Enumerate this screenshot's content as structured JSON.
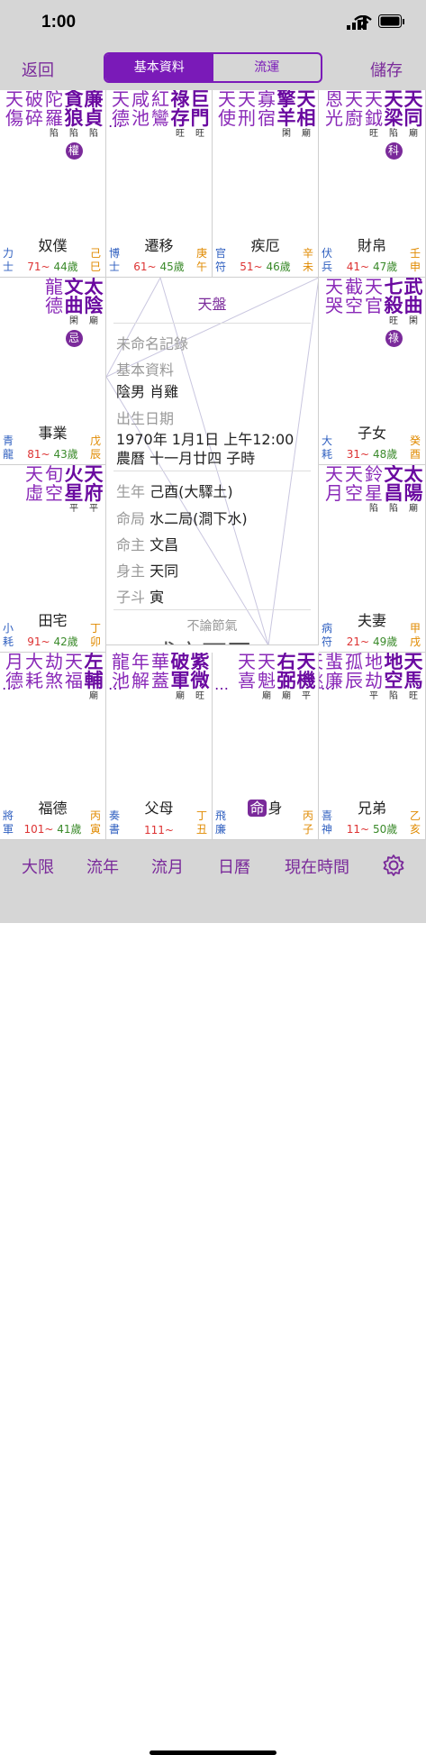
{
  "status": {
    "time": "1:00"
  },
  "nav": {
    "back": "返回",
    "tab_basic": "基本資料",
    "tab_flow": "流運",
    "save": "儲存"
  },
  "palaces": [
    {
      "name": "奴僕",
      "stars": [
        "天傷",
        "破碎",
        "陀羅",
        "貪狼",
        "廉貞"
      ],
      "brightness": [
        "陷",
        "陷",
        "陷"
      ],
      "hua": "權",
      "lt": "力士",
      "gz": "己巳",
      "age1": "71~",
      "age2": "44歲"
    },
    {
      "name": "遷移",
      "stars": [
        "天德",
        "咸池",
        "紅鸞",
        "祿存",
        "巨門"
      ],
      "brightness": [
        "旺",
        "旺"
      ],
      "more": "…",
      "lt": "博士",
      "gz": "庚午",
      "age1": "61~",
      "age2": "45歲"
    },
    {
      "name": "疾厄",
      "stars": [
        "天使",
        "天刑",
        "寡宿",
        "擎羊",
        "天相"
      ],
      "brightness": [
        "廟",
        "閑"
      ],
      "lt": "官符",
      "gz": "辛未",
      "age1": "51~",
      "age2": "46歲"
    },
    {
      "name": "財帛",
      "stars": [
        "恩光",
        "天廚",
        "天鉞",
        "天梁",
        "天同"
      ],
      "brightness": [
        "廟",
        "陷",
        "旺"
      ],
      "hua": "科",
      "lt": "伏兵",
      "gz": "壬申",
      "age1": "41~",
      "age2": "47歲"
    },
    {
      "name": "事業",
      "stars": [
        "龍德",
        "文曲",
        "太陰"
      ],
      "brightness": [
        "廟",
        "閑"
      ],
      "hua": "忌",
      "lt": "青龍",
      "gz": "戊辰",
      "age1": "81~",
      "age2": "43歲"
    },
    {
      "name": "子女",
      "stars": [
        "天哭",
        "截空",
        "天官",
        "七殺",
        "武曲"
      ],
      "brightness": [
        "閑",
        "旺"
      ],
      "hua": "祿",
      "lt": "大耗",
      "gz": "癸酉",
      "age1": "31~",
      "age2": "48歲"
    },
    {
      "name": "田宅",
      "stars": [
        "天虛",
        "旬空",
        "火星",
        "天府"
      ],
      "brightness": [
        "平",
        "平"
      ],
      "lt": "小耗",
      "gz": "丁卯",
      "age1": "91~",
      "age2": "42歲"
    },
    {
      "name": "夫妻",
      "stars": [
        "天月",
        "天空",
        "鈴星",
        "文昌",
        "太陽"
      ],
      "brightness": [
        "廟",
        "陷",
        "陷"
      ],
      "lt": "病符",
      "gz": "甲戌",
      "age1": "21~",
      "age2": "49歲"
    },
    {
      "name": "福德",
      "stars": [
        "月德",
        "大耗",
        "劫煞",
        "天福",
        "左輔"
      ],
      "brightness": [
        "廟"
      ],
      "more": "…",
      "lt": "將軍",
      "gz": "丙寅",
      "age1": "101~",
      "age2": "41歲"
    },
    {
      "name": "父母",
      "stars": [
        "龍池",
        "年解",
        "華蓋",
        "破軍",
        "紫微"
      ],
      "brightness": [
        "旺",
        "廟"
      ],
      "more": "…",
      "lt": "奏書",
      "gz": "丁丑",
      "age1": "111~",
      "age2": ""
    },
    {
      "name": "身",
      "ming": "命",
      "stars": [
        "天喜",
        "天魁",
        "右弼",
        "天機"
      ],
      "brightness": [
        "平",
        "廟",
        "廟"
      ],
      "more": "…",
      "lt": "飛廉",
      "gz": "丙子",
      "age1": "",
      "age2": ""
    },
    {
      "name": "兄弟",
      "stars": [
        "天姚",
        "蜚廉",
        "孤辰",
        "地劫",
        "地空",
        "天馬"
      ],
      "brightness": [
        "旺",
        "陷",
        "平"
      ],
      "more": "…",
      "lt": "喜神",
      "gz": "乙亥",
      "age1": "11~",
      "age2": "50歲"
    }
  ],
  "center": {
    "title": "天盤",
    "unnamed": "未命名記錄",
    "basic": "基本資料",
    "gender": "陰男 肖雞",
    "birth_label": "出生日期",
    "solar": "1970年 1月1日 上午12:00",
    "lunar": "農曆 十一月廿四 子時",
    "year_label": "生年",
    "year": "己酉(大驛土)",
    "ju_label": "命局",
    "ju": "水二局(澗下水)",
    "mz_label": "命主",
    "mz": "文昌",
    "sz_label": "身主",
    "sz": "天同",
    "zd_label": "子斗",
    "zd": "寅",
    "jieqi": "不論節氣",
    "big": "成辛西司"
  },
  "tabbar": {
    "t1": "大限",
    "t2": "流年",
    "t3": "流月",
    "t4": "日曆",
    "t5": "現在時間"
  },
  "colors": {
    "accent": "#7a2a9a",
    "major": "#6a0aa0"
  }
}
